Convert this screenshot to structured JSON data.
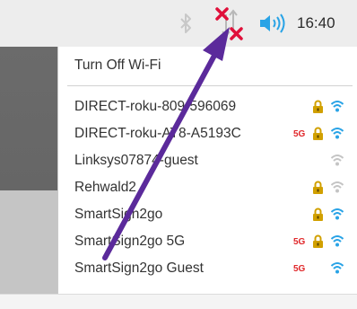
{
  "panel": {
    "clock": "16:40",
    "icons": [
      "bluetooth-icon",
      "network-disconnected-icon",
      "volume-icon"
    ]
  },
  "menu": {
    "turn_off_wifi": "Turn Off Wi-Fi",
    "networks": [
      {
        "ssid": "DIRECT-roku-809-596069",
        "band": "",
        "locked": true,
        "signal": "strong"
      },
      {
        "ssid": "DIRECT-roku-AT8-A5193C",
        "band": "5G",
        "locked": true,
        "signal": "strong"
      },
      {
        "ssid": "Linksys07874-guest",
        "band": "",
        "locked": false,
        "signal": "weak"
      },
      {
        "ssid": "Rehwald2",
        "band": "",
        "locked": true,
        "signal": "weak"
      },
      {
        "ssid": "SmartSign2go",
        "band": "",
        "locked": true,
        "signal": "strong"
      },
      {
        "ssid": "SmartSign2go 5G",
        "band": "5G",
        "locked": true,
        "signal": "strong"
      },
      {
        "ssid": "SmartSign2go Guest",
        "band": "5G",
        "locked": false,
        "signal": "strong"
      }
    ]
  },
  "colors": {
    "wifi_strong": "#29a3e6",
    "wifi_weak": "#c4c4c4",
    "lock": "#d1a000",
    "badge_5g": "#e0272a",
    "annotation_arrow": "#5b2a9b",
    "disconnected_x": "#e0103a"
  }
}
